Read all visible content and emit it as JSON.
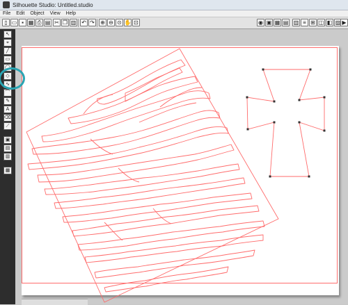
{
  "window": {
    "title": "Silhouette Studio: Untitled.studio"
  },
  "menu": [
    "File",
    "Edit",
    "Object",
    "View",
    "Help"
  ],
  "toolbar_left": [
    {
      "name": "new-document-icon",
      "glyph": "▯"
    },
    {
      "name": "open-folder-icon",
      "glyph": "▭"
    },
    {
      "name": "save-icon",
      "glyph": "▪"
    },
    {
      "name": "library-icon",
      "glyph": "▦"
    },
    {
      "name": "print-icon",
      "glyph": "⎙"
    },
    {
      "name": "cut-send-icon",
      "glyph": "▤"
    },
    {
      "name": "cut-icon",
      "glyph": "✂"
    },
    {
      "name": "copy-icon",
      "glyph": "❐"
    },
    {
      "name": "paste-icon",
      "glyph": "▥"
    },
    {
      "name": "undo-icon",
      "glyph": "↶"
    },
    {
      "name": "redo-icon",
      "glyph": "↷"
    },
    {
      "name": "zoom-in-icon",
      "glyph": "⊕"
    },
    {
      "name": "zoom-out-icon",
      "glyph": "⊖"
    },
    {
      "name": "zoom-select-icon",
      "glyph": "⊙"
    },
    {
      "name": "pan-icon",
      "glyph": "✋"
    },
    {
      "name": "fit-page-icon",
      "glyph": "⊡"
    }
  ],
  "toolbar_right": [
    {
      "name": "shop-icon",
      "glyph": "◉"
    },
    {
      "name": "page-settings-icon",
      "glyph": "▣"
    },
    {
      "name": "registration-marks-icon",
      "glyph": "▦"
    },
    {
      "name": "cut-settings-icon",
      "glyph": "▤"
    },
    {
      "name": "grid-icon",
      "glyph": "▥"
    },
    {
      "name": "align-icon",
      "glyph": "≡"
    },
    {
      "name": "replicate-icon",
      "glyph": "⊞"
    },
    {
      "name": "weld-icon",
      "glyph": "◫"
    },
    {
      "name": "offset-icon",
      "glyph": "◧"
    },
    {
      "name": "trace-icon",
      "glyph": "▨"
    },
    {
      "name": "send-to-silhouette-icon",
      "glyph": "▶"
    }
  ],
  "left_tools": [
    {
      "name": "select-tool-icon",
      "glyph": "↖"
    },
    {
      "name": "edit-points-tool-icon",
      "glyph": "⌖"
    },
    {
      "name": "line-tool-icon",
      "glyph": "╱"
    },
    {
      "name": "rectangle-tool-icon",
      "glyph": "▭"
    },
    {
      "name": "ellipse-tool-icon",
      "glyph": "◯"
    },
    {
      "name": "polygon-tool-icon",
      "glyph": "◇"
    },
    {
      "name": "curve-tool-icon",
      "glyph": "∿"
    },
    {
      "name": "arc-tool-icon",
      "glyph": "⌒"
    },
    {
      "name": "freehand-tool-icon",
      "glyph": "✎"
    },
    {
      "name": "text-tool-icon",
      "glyph": "A"
    },
    {
      "name": "eraser-tool-icon",
      "glyph": "⌫"
    },
    {
      "name": "knife-tool-icon",
      "glyph": "⟋"
    },
    {
      "name": "fill-panel-icon",
      "glyph": "▣"
    },
    {
      "name": "line-style-panel-icon",
      "glyph": "▤"
    },
    {
      "name": "library-panel-icon",
      "glyph": "▥"
    },
    {
      "name": "store-panel-icon",
      "glyph": "▦"
    }
  ],
  "colors": {
    "cut_line": "#ff6b6b",
    "highlight": "#2aa5b3",
    "point": "#333333"
  }
}
